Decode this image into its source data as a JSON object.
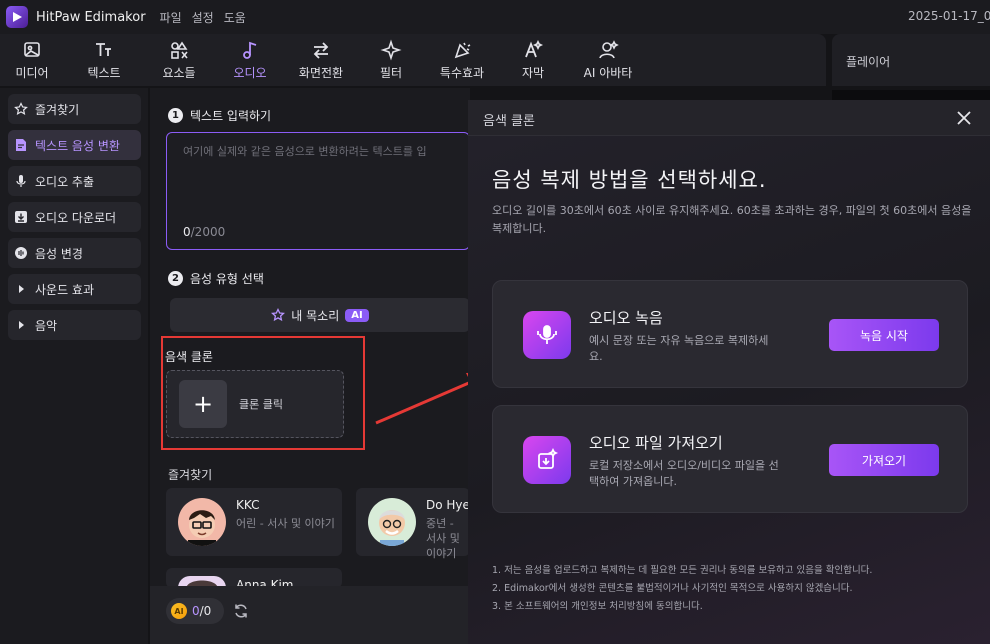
{
  "titlebar": {
    "app_title": "HitPaw Edimakor",
    "menu": [
      "파일",
      "설정",
      "도움"
    ],
    "date": "2025-01-17_0"
  },
  "toolbar": {
    "tools": [
      {
        "label": "미디어",
        "icon": "media-icon"
      },
      {
        "label": "텍스트",
        "icon": "text-icon"
      },
      {
        "label": "요소들",
        "icon": "elements-icon"
      },
      {
        "label": "오디오",
        "icon": "audio-icon",
        "active": true
      },
      {
        "label": "화면전환",
        "icon": "transition-icon"
      },
      {
        "label": "필터",
        "icon": "filter-icon"
      },
      {
        "label": "특수효과",
        "icon": "effects-icon"
      },
      {
        "label": "자막",
        "icon": "subtitle-icon"
      },
      {
        "label": "AI 아바타",
        "icon": "ai-avatar-icon"
      }
    ]
  },
  "player": {
    "title": "플레이어"
  },
  "sidebar": {
    "items": [
      {
        "label": "즐겨찾기",
        "icon": "star-icon"
      },
      {
        "label": "텍스트 음성 변환",
        "icon": "tts-icon",
        "active": true
      },
      {
        "label": "오디오 추출",
        "icon": "mic-icon"
      },
      {
        "label": "오디오 다운로더",
        "icon": "download-icon"
      },
      {
        "label": "음성 변경",
        "icon": "voice-change-icon"
      },
      {
        "label": "사운드 효과",
        "icon": "caret-right-icon"
      },
      {
        "label": "음악",
        "icon": "caret-right-icon"
      }
    ]
  },
  "center": {
    "step1": {
      "num": "1",
      "label": "텍스트 입력하기"
    },
    "textarea": {
      "placeholder": "여기에 실제와 같은 음성으로 변환하려는 텍스트를 입",
      "count": "0",
      "max": "/2000"
    },
    "step2": {
      "num": "2",
      "label": "음성 유형 선택"
    },
    "my_voice": {
      "label": "내 목소리",
      "badge": "AI"
    },
    "clone_label": "음색 클론",
    "clone_button": "클론 클릭",
    "favorites_label": "즐겨찾기",
    "voices": [
      {
        "name": "KKC",
        "desc": "어린 - 서사 및 이야기"
      },
      {
        "name": "Do Hye",
        "desc": "중년 - 서사 및 이야기"
      },
      {
        "name": "Anna Kim",
        "desc": ""
      }
    ],
    "credits": {
      "coin": "AI",
      "used": "0",
      "total": "/0"
    }
  },
  "modal": {
    "title": "음색 클론",
    "heading": "음성 복제 방법을 선택하세요.",
    "description": "오디오 길이를 30초에서 60초 사이로 유지해주세요. 60초를 초과하는 경우, 파일의 첫 60초에서 음성을 복제합니다.",
    "options": [
      {
        "title": "오디오 녹음",
        "desc": "예시 문장 또는 자유 녹음으로 복제하세요.",
        "button": "녹음 시작",
        "icon": "mic-record-icon"
      },
      {
        "title": "오디오 파일 가져오기",
        "desc": "로컬 저장소에서 오디오/비디오 파일을 선택하여 가져옵니다.",
        "button": "가져오기",
        "icon": "import-file-icon"
      }
    ],
    "notes": [
      "1. 저는 음성을 업로드하고 복제하는 데 필요한 모든 권리나 동의를 보유하고 있음을 확인합니다.",
      "2. Edimakor에서 생성한 콘텐츠를 불법적이거나 사기적인 목적으로 사용하지 않겠습니다.",
      "3. 본 소프트웨어의 개인정보 처리방침에 동의합니다."
    ]
  },
  "colors": {
    "accent": "#8b5cf6",
    "highlight": "#e53935",
    "background": "#141417"
  }
}
